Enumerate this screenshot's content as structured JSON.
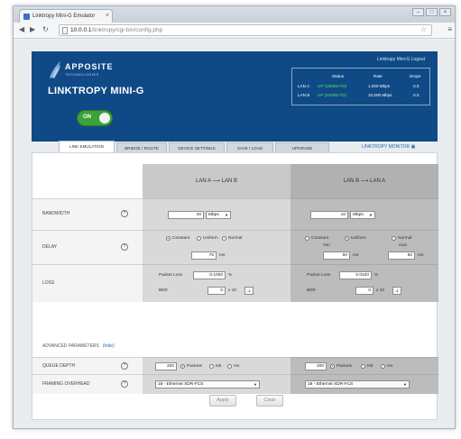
{
  "browser": {
    "tab_title": "Linktropy Mini-G Emulator",
    "tab_close": "×",
    "address_host": "10.0.0.1",
    "address_path": "/linktropy/cgi-bin/config.php",
    "window_controls": [
      "–",
      "□",
      "×"
    ]
  },
  "header": {
    "brand": "APPOSITE",
    "brand_sub": "TECHNOLOGIES",
    "product": "LINKTROPY MINI-G",
    "toggle_label": "ON",
    "top_link": "Linktropy Mini-G  Logout",
    "status": {
      "col_status": "Status",
      "col_rate": "Rate",
      "col_drops": "Drops",
      "rows": [
        {
          "name": "LAN A",
          "status": "UP (1000M FD)",
          "rate": "1,000 Mbps",
          "drops": "0.0"
        },
        {
          "name": "LAN B",
          "status": "UP (1000M FD)",
          "rate": "10,000 Mbps",
          "drops": "0.0"
        }
      ]
    }
  },
  "tabs": [
    {
      "label": "LINK EMULATION",
      "active": true
    },
    {
      "label": "BRIDGE / ROUTE",
      "active": false
    },
    {
      "label": "DEVICE SETTINGS",
      "active": false
    },
    {
      "label": "SAVE / LOAD",
      "active": false
    },
    {
      "label": "UPGRADE",
      "active": false
    }
  ],
  "monitor_link": "LINKTROPY MONITOR",
  "columns": {
    "a": "LAN A ⟶ LAN B",
    "b": "LAN B ⟶ LAN A"
  },
  "rows": {
    "bandwidth": {
      "label": "BANDWIDTH",
      "a_value": "40",
      "a_unit": "Mbps",
      "b_value": "10",
      "b_unit": "Mbps"
    },
    "delay": {
      "label": "DELAY",
      "options": [
        "Constant",
        "Uniform",
        "Normal"
      ],
      "a_value": "75",
      "unit": "ms",
      "b_min_label": "min",
      "b_max_label": "max",
      "b_min": "50",
      "b_max": "50"
    },
    "loss": {
      "label": "LOSS",
      "packet_loss_label": "Packet Loss",
      "ber_label": "BER",
      "a_loss": "0.1000",
      "b_loss": "0.0100",
      "pct": "%",
      "a_ber": "0",
      "b_ber": "0",
      "ber_exp": "x 10",
      "ber_btn": "-1"
    },
    "advanced": {
      "label": "ADVANCED PARAMETERS",
      "toggle": "(hide)"
    },
    "queue": {
      "label": "QUEUE DEPTH",
      "a_value": "200",
      "b_value": "200",
      "options": [
        "Packets",
        "KB",
        "ms"
      ]
    },
    "framing": {
      "label": "FRAMING OVERHEAD",
      "a_value": "18 - Ethernet XDR-FCS",
      "b_value": "18 - Ethernet XDR-FCS"
    }
  },
  "buttons": {
    "apply": "Apply",
    "clear": "Clear"
  },
  "colors": {
    "header_bg": "#0f4a86",
    "toggle_on": "#3ba239",
    "status_up": "#57e65a",
    "link": "#2a63b0"
  },
  "icons": [
    "page-icon",
    "star-icon",
    "wrench-icon",
    "help-icon",
    "monitor-icon"
  ]
}
